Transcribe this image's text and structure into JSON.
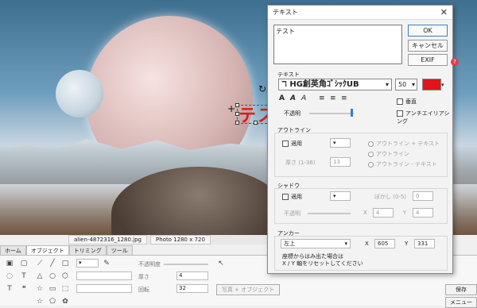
{
  "canvas": {
    "overlay_text": "テス",
    "status": {
      "filename": "alien-4872316_1280.jpg",
      "photo_info": "Photo 1280 x 720"
    }
  },
  "left_panel": {
    "tabs": [
      "ホーム",
      "オブジェクト",
      "トリミング",
      "ツール"
    ],
    "active_tab": "オブジェクト",
    "opacity_label": "不透明度",
    "thickness_label": "厚さ",
    "thickness_value": "4",
    "rotation_label": "回転",
    "rotation_value": "32",
    "photo_object_button": "写真 + オブジェクト"
  },
  "right_buttons": {
    "save": "保存",
    "menu": "メニュー"
  },
  "dialog": {
    "title": "テキスト",
    "textarea_value": "テスト",
    "ok": "OK",
    "cancel": "キャンセル",
    "exif": "EXIF",
    "help": "?",
    "text_section": "テキスト",
    "font_name": "HG創英角ｺﾞｼｯｸUB",
    "font_size": "50",
    "text_color": "#e0141a",
    "style_buttons": [
      "A",
      "A",
      "A"
    ],
    "vertical_label": "垂直",
    "opacity_label": "不透明",
    "antialias_label": "アンチエイリアシング",
    "outline_section": "アウトライン",
    "outline_apply": "適用",
    "outline_thickness_label": "厚さ (1-36)",
    "outline_thickness_value": "13",
    "outline_options": [
      "アウトライン + テキスト",
      "アウトライン",
      "アウトライン - テキスト"
    ],
    "shadow_section": "シャドウ",
    "shadow_apply": "適用",
    "blur_label": "ぼかし (0-5)",
    "blur_value": "0",
    "shadow_opacity_label": "不透明",
    "x_label": "X",
    "x_value": "4",
    "y_label": "Y",
    "y_value": "4",
    "anchor_section": "アンカー",
    "anchor_value": "左上",
    "anchor_x_label": "X",
    "anchor_x_value": "605",
    "anchor_y_label": "Y",
    "anchor_y_value": "331",
    "note": "座標からはみ出た場合は\nX / Y 軸をリセットしてください"
  }
}
